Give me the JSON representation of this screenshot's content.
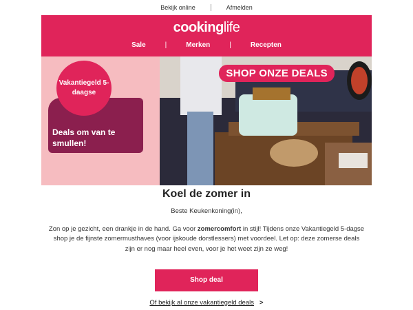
{
  "preheader": {
    "view_online": "Bekijk online",
    "unsubscribe": "Afmelden"
  },
  "header": {
    "logo_bold": "cooking",
    "logo_light": "life",
    "nav": [
      "Sale",
      "Merken",
      "Recepten"
    ],
    "nav_separator": "|"
  },
  "hero": {
    "badge": "Vakantiegeld 5-daagse",
    "tagline": "Deals om van te smullen!",
    "banner": "SHOP ONZE DEALS"
  },
  "content": {
    "title": "Koel de zomer in",
    "greeting": "Beste Keukenkoning(in),",
    "body_part1": "Zon op je gezicht, een drankje in de hand. Ga voor ",
    "body_bold": "zomercomfort",
    "body_part2": " in stijl! Tijdens onze Vakantiegeld 5-dagse shop je de fijnste zomermusthaves (voor ijskoude dorstlessers) met voordeel. Let op: deze zomerse deals zijn er nog maar heel even, voor je het weet zijn ze weg!",
    "cta": "Shop deal",
    "secondary_link": "Of bekijk al onze vakantiegeld deals",
    "chevron": ">"
  },
  "colors": {
    "brand": "#e0245a",
    "plum": "#8b1f4e",
    "pink_bg": "#f6bcc0"
  }
}
